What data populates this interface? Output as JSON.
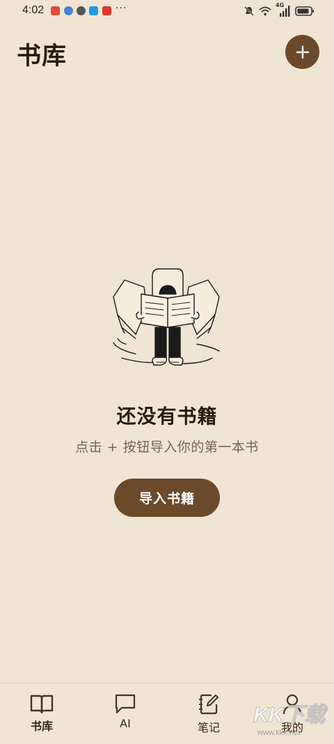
{
  "status_bar": {
    "time": "4:02",
    "more": "···",
    "network": "4G"
  },
  "header": {
    "title": "书库",
    "add_label": "+"
  },
  "empty_state": {
    "title": "还没有书籍",
    "subtitle": "点击 + 按钮导入你的第一本书",
    "button_label": "导入书籍"
  },
  "bottom_nav": {
    "items": [
      {
        "label": "书库",
        "icon": "book-open-icon",
        "active": true
      },
      {
        "label": "AI",
        "icon": "chat-bubble-icon",
        "active": false
      },
      {
        "label": "笔记",
        "icon": "notebook-pen-icon",
        "active": false
      },
      {
        "label": "我的",
        "icon": "user-icon",
        "active": false
      }
    ]
  },
  "watermark": {
    "text": "KK下载",
    "url": "www.kkx.net"
  },
  "colors": {
    "background": "#f0e5d3",
    "accent": "#6b4a2b",
    "title_text": "#2b1a0c",
    "subtitle_text": "#7a6350"
  }
}
